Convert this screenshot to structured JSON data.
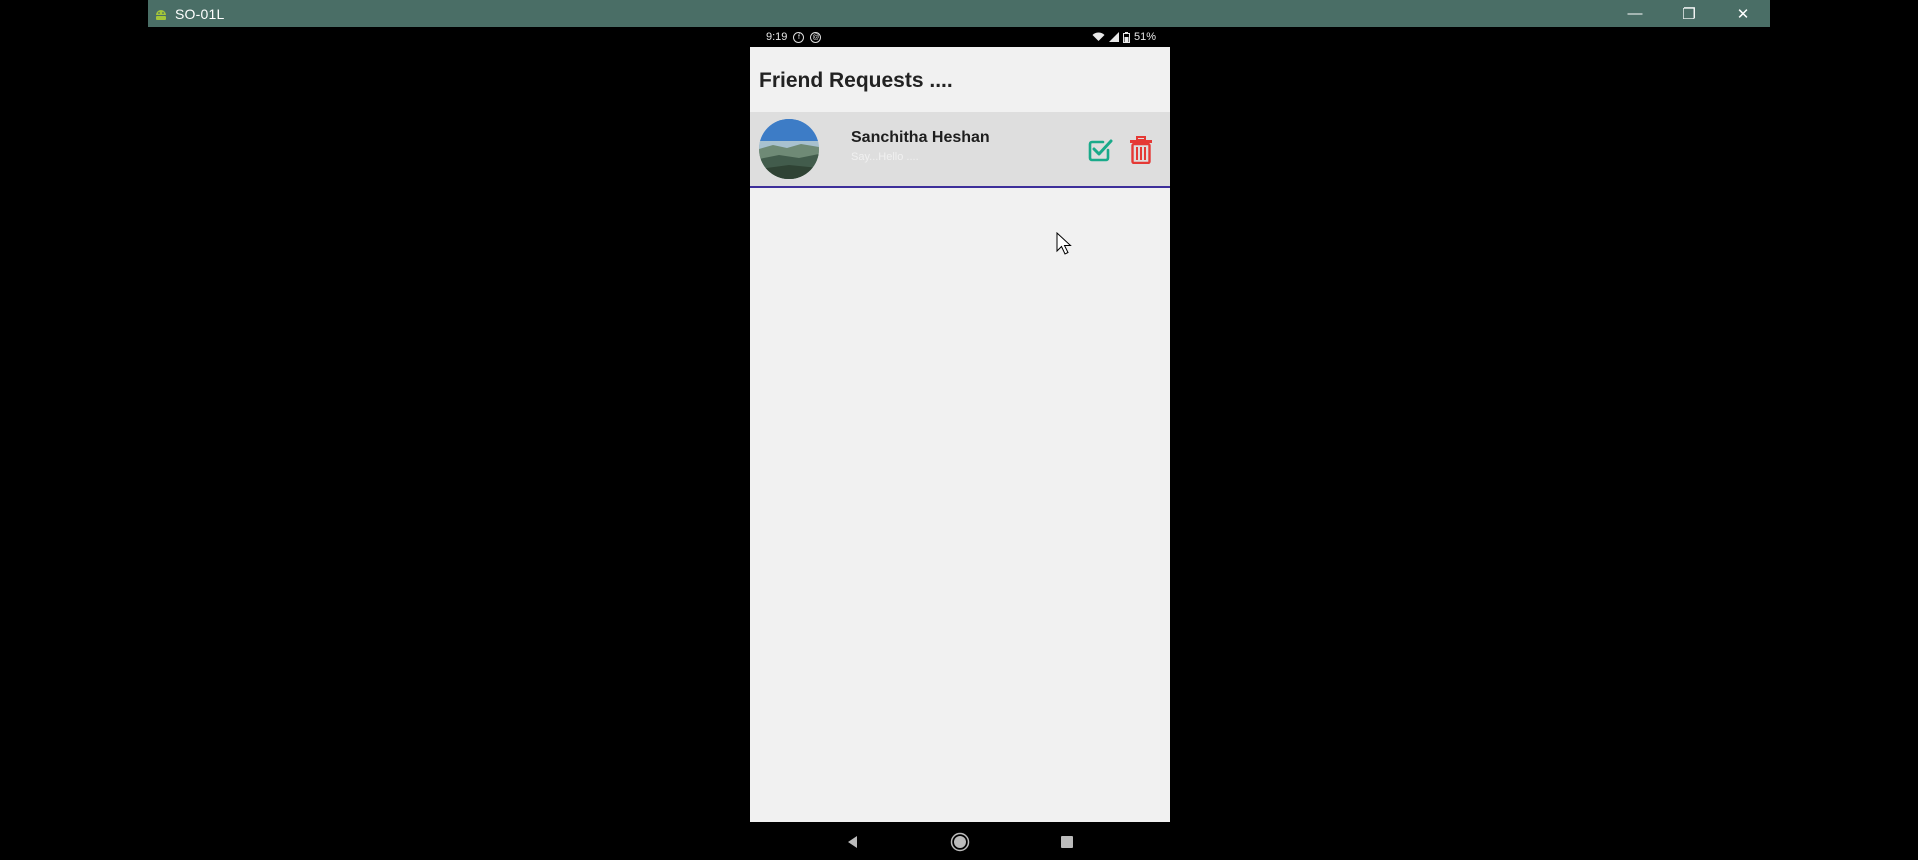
{
  "window": {
    "title": "SO-01L",
    "minimize_glyph": "—",
    "restore_glyph": "❐",
    "close_glyph": "✕"
  },
  "status_bar": {
    "time": "9:19",
    "battery": "51%"
  },
  "page": {
    "title": "Friend Requests ...."
  },
  "requests": [
    {
      "name": "Sanchitha Heshan",
      "status": "Say...Hello ...."
    }
  ],
  "colors": {
    "titlebar": "#4a6e66",
    "accept": "#1aaa8a",
    "delete": "#e53935",
    "row_divider": "#3d2f9a"
  }
}
